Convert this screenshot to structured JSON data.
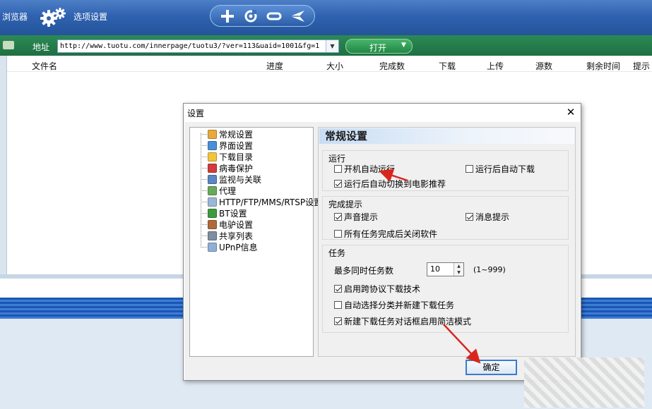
{
  "toolbar": {
    "browser_label": "浏览器",
    "options_label": "选项设置",
    "pill_icons": [
      "plus-icon",
      "refresh-icon",
      "minus-icon",
      "send-icon"
    ]
  },
  "address": {
    "label": "地址",
    "url": "http://www.tuotu.com/innerpage/tuotu3/?ver=113&uaid=1001&fg=1",
    "open_label": "打开",
    "dropdown_glyph": "▼"
  },
  "columns": [
    "文件名",
    "进度",
    "大小",
    "完成数",
    "下载",
    "上传",
    "源数",
    "剩余时间",
    "提示"
  ],
  "dialog": {
    "title": "设置",
    "close_glyph": "✕",
    "tree": [
      {
        "label": "常规设置",
        "icon": "general-settings-icon",
        "color": "#e9a93a"
      },
      {
        "label": "界面设置",
        "icon": "interface-icon",
        "color": "#4a8fd6"
      },
      {
        "label": "下载目录",
        "icon": "download-folder-icon",
        "color": "#f0c53c"
      },
      {
        "label": "病毒保护",
        "icon": "virus-shield-icon",
        "color": "#d23c3c"
      },
      {
        "label": "监视与关联",
        "icon": "monitor-icon",
        "color": "#5a86c2"
      },
      {
        "label": "代理",
        "icon": "proxy-icon",
        "color": "#6aa95a"
      },
      {
        "label": "HTTP/FTP/MMS/RTSP设置",
        "icon": "protocol-icon",
        "color": "#9ab7d8"
      },
      {
        "label": "BT设置",
        "icon": "bt-icon",
        "color": "#3f9a3f"
      },
      {
        "label": "电驴设置",
        "icon": "emule-icon",
        "color": "#b06a3a"
      },
      {
        "label": "共享列表",
        "icon": "share-list-icon",
        "color": "#7f8ea0"
      },
      {
        "label": "UPnP信息",
        "icon": "upnp-icon",
        "color": "#8fb0d6"
      }
    ],
    "panel_title": "常规设置",
    "groups": {
      "run": {
        "title": "运行",
        "autostart": {
          "label": "开机自动运行",
          "checked": false
        },
        "autodownload": {
          "label": "运行后自动下载",
          "checked": false
        },
        "switch_movie": {
          "label": "运行后自动切换到电影推荐",
          "checked": true
        }
      },
      "complete": {
        "title": "完成提示",
        "sound": {
          "label": "声音提示",
          "checked": true
        },
        "message": {
          "label": "消息提示",
          "checked": true
        },
        "close_after": {
          "label": "所有任务完成后关闭软件",
          "checked": false
        }
      },
      "tasks": {
        "title": "任务",
        "max_label": "最多同时任务数",
        "max_value": "10",
        "range": "(1~999)",
        "cross_protocol": {
          "label": "启用跨协议下载技术",
          "checked": true
        },
        "auto_category": {
          "label": "自动选择分类并新建下载任务",
          "checked": false
        },
        "simple_mode": {
          "label": "新建下载任务对话框启用简洁模式",
          "checked": true
        }
      }
    },
    "ok_label": "确定"
  },
  "colors": {
    "toolbar_blue": "#2f62b0",
    "address_green": "#1f6f42",
    "arrow_red": "#d9261c",
    "ok_border": "#3b7bd1"
  }
}
